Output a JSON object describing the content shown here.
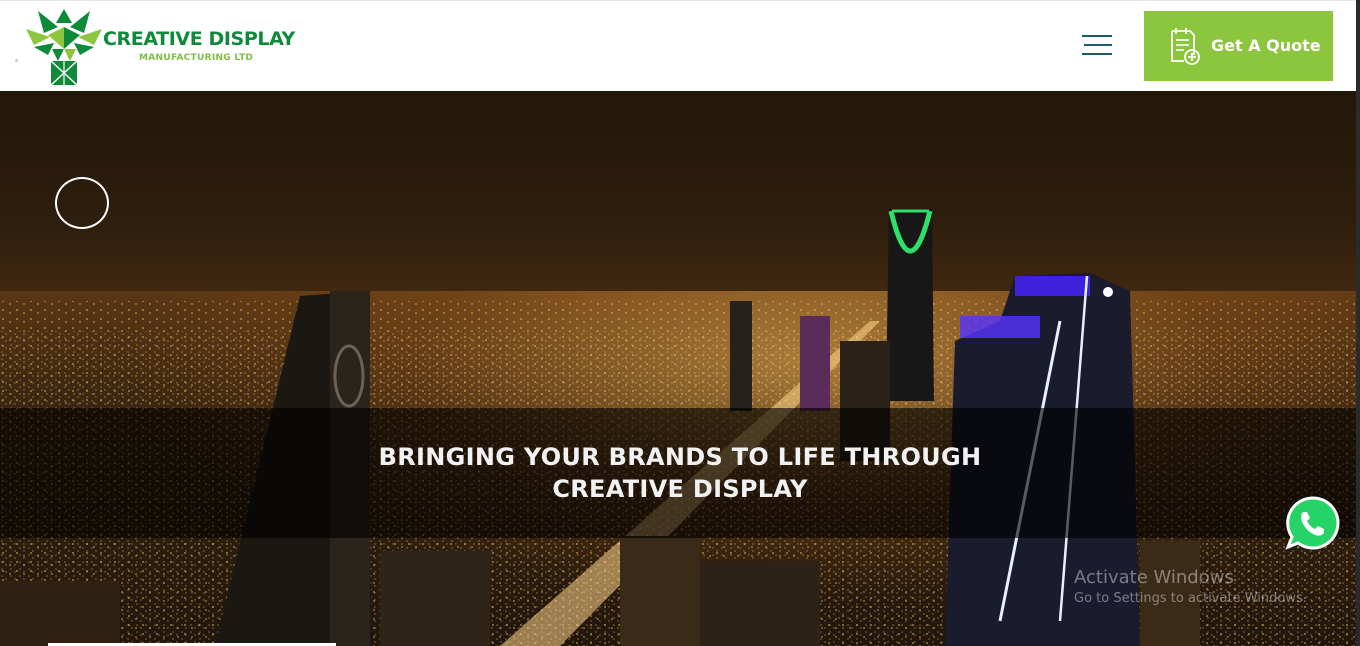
{
  "header": {
    "brand_name": "CREATIVE DISPLAY",
    "brand_subtitle": "MANUFACTURING LTD",
    "menu_icon": "hamburger-icon",
    "quote_button_label": "Get A Quote",
    "quote_icon": "quote-document-icon"
  },
  "hero": {
    "tagline_line1": "BRINGING YOUR BRANDS TO LIFE THROUGH",
    "tagline_line2": "CREATIVE DISPLAY",
    "circle_icon": "circle-icon"
  },
  "floating": {
    "whatsapp_icon": "whatsapp-icon"
  },
  "watermark": {
    "title": "Activate Windows",
    "subtitle": "Go to Settings to activate Windows."
  },
  "colors": {
    "brand_green": "#0e8a3a",
    "accent_green": "#8cc63f",
    "menu_color": "#1c5c6e",
    "whatsapp_green": "#25d366"
  }
}
